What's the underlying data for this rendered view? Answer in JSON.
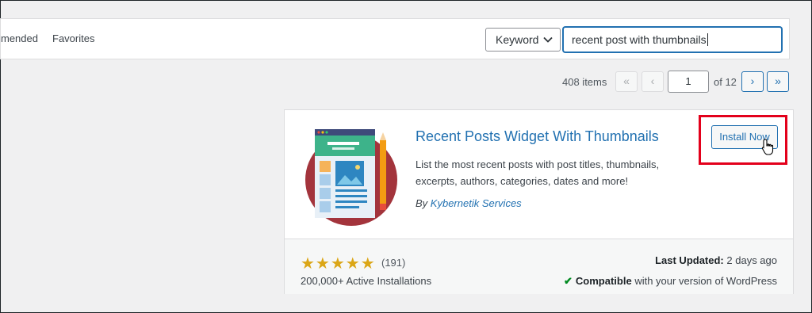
{
  "filter_bar": {
    "tabs": [
      "mended",
      "Favorites"
    ],
    "search_type": "Keyword",
    "search_value": "recent post with thumbnails"
  },
  "pagination": {
    "items": "408 items",
    "first": "«",
    "prev": "‹",
    "current_page": "1",
    "of_pages": "of 12",
    "next": "›",
    "last": "»"
  },
  "plugin": {
    "name": "Recent Posts Widget With Thumbnails",
    "description": "List the most recent posts with post titles, thumbnails, excerpts, authors, categories, dates and more!",
    "author_prefix": "By",
    "author": "Kybernetik Services",
    "install_label": "Install Now",
    "stars": "★★★★★",
    "rating_count": "(191)",
    "active_installs": "200,000+ Active Installations",
    "last_updated_label": "Last Updated:",
    "last_updated_value": "2 days ago",
    "compat_check": "✔",
    "compat_bold": "Compatible",
    "compat_rest": "with your version of WordPress"
  },
  "colors": {
    "accent": "#2271b1",
    "star": "#dba617",
    "highlight": "#e3001b",
    "compatible": "#008a20"
  }
}
